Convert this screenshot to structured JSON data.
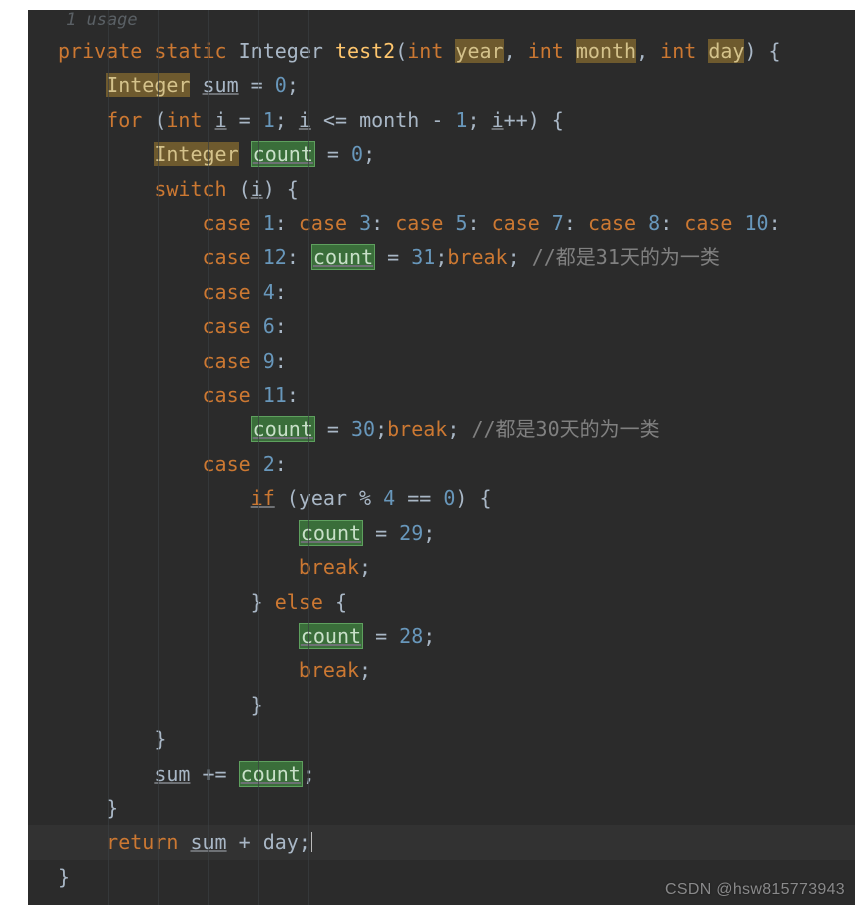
{
  "usage_hint": "1 usage",
  "watermark": "CSDN @hsw815773943",
  "tokens": {
    "private": "private",
    "static": "static",
    "IntegerType": "Integer",
    "int": "int",
    "test2": "test2",
    "year": "year",
    "month": "month",
    "day": "day",
    "sum": "sum",
    "count": "count",
    "for": "for",
    "switch": "switch",
    "case": "case",
    "break": "break",
    "if": "if",
    "else": "else",
    "return": "return",
    "i": "i",
    "eq0": "0",
    "eq1": "1",
    "n2": "2",
    "n3": "3",
    "n4": "4",
    "n5": "5",
    "n6": "6",
    "n7": "7",
    "n8": "8",
    "n9": "9",
    "n10": "10",
    "n11": "11",
    "n12": "12",
    "n28": "28",
    "n29": "29",
    "n30": "30",
    "n31": "31",
    "comment31": "//都是31天的为一类",
    "comment30": "//都是30天的为一类"
  },
  "code_plain": "private static Integer test2(int year, int month, int day) {\n    Integer sum = 0;\n    for (int i = 1; i <= month - 1; i++) {\n        Integer count = 0;\n        switch (i) {\n            case 1: case 3: case 5: case 7: case 8: case 10:\n            case 12: count = 31;break; //都是31天的为一类\n            case 4:\n            case 6:\n            case 9:\n            case 11:\n                count = 30;break; //都是30天的为一类\n            case 2:\n                if (year % 4 == 0) {\n                    count = 29;\n                    break;\n                } else {\n                    count = 28;\n                    break;\n                }\n        }\n        sum += count;\n    }\n    return sum + day;\n}"
}
